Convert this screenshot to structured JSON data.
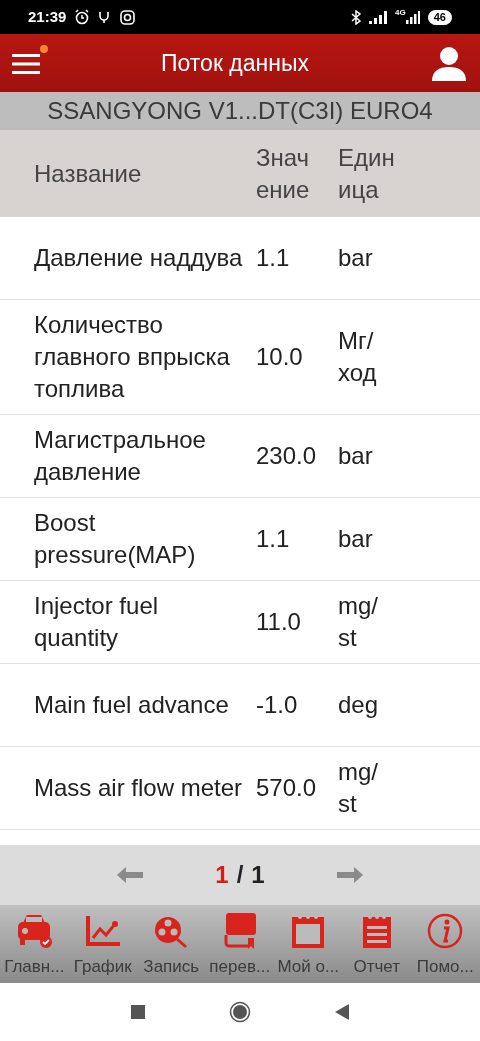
{
  "status_bar": {
    "time": "21:39",
    "network": "4G",
    "battery": "46"
  },
  "app_bar": {
    "title": "Поток данных",
    "notification_dot": true
  },
  "vehicle": "SSANGYONG V1...DT(C3I) EURO4",
  "table": {
    "columns": [
      "Название",
      "Значение",
      "Единица"
    ],
    "rows": [
      {
        "name": "Давление наддува",
        "value": "1.1",
        "unit": "bar"
      },
      {
        "name": "Количество главного впрыска топлива",
        "value": "10.0",
        "unit": "Мг/ход"
      },
      {
        "name": "Магистральное давление",
        "value": "230.0",
        "unit": "bar"
      },
      {
        "name": "Boost pressure(MAP)",
        "value": "1.1",
        "unit": "bar"
      },
      {
        "name": "Injector fuel quantity",
        "value": "11.0",
        "unit": "mg/st"
      },
      {
        "name": "Main fuel advance",
        "value": "-1.0",
        "unit": "deg"
      },
      {
        "name": "Mass air flow meter",
        "value": "570.0",
        "unit": "mg/st"
      }
    ]
  },
  "pager": {
    "current": "1",
    "separator": "/",
    "total": "1"
  },
  "bottom_nav": [
    {
      "kind": "car",
      "label": "Главн..."
    },
    {
      "kind": "graph",
      "label": "График"
    },
    {
      "kind": "record",
      "label": "Запись"
    },
    {
      "kind": "translate",
      "label": "перев..."
    },
    {
      "kind": "calendar",
      "label": "Мой о..."
    },
    {
      "kind": "report",
      "label": "Отчет"
    },
    {
      "kind": "info",
      "label": "Помо..."
    }
  ]
}
